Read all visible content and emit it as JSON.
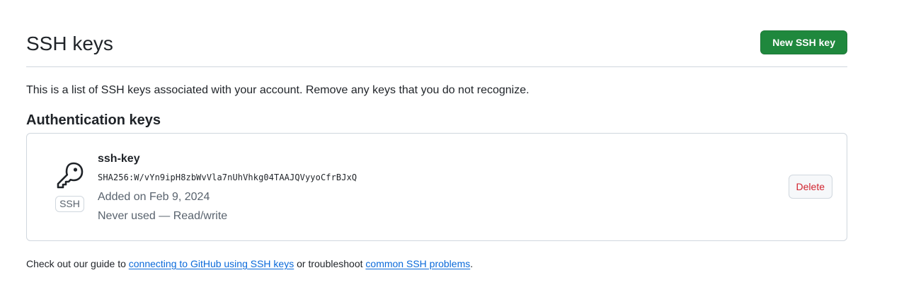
{
  "header": {
    "title": "SSH keys",
    "new_key_label": "New SSH key"
  },
  "intro": "This is a list of SSH keys associated with your account. Remove any keys that you do not recognize.",
  "section_heading": "Authentication keys",
  "keys": [
    {
      "icon": "key-icon",
      "badge": "SSH",
      "title": "ssh-key",
      "fingerprint": "SHA256:W/vYn9ipH8zbWvVla7nUhVhkg04TAAJQVyyoCfrBJxQ",
      "added": "Added on Feb 9, 2024",
      "usage": "Never used — Read/write",
      "delete_label": "Delete"
    }
  ],
  "footer": {
    "prefix": "Check out our guide to ",
    "guide_link": "connecting to GitHub using SSH keys",
    "middle": " or troubleshoot ",
    "troubleshoot_link": "common SSH problems",
    "suffix": "."
  },
  "colors": {
    "primary_button": "#1f883d",
    "danger_text": "#d1242f",
    "link": "#0969da",
    "border": "#d0d7de"
  }
}
